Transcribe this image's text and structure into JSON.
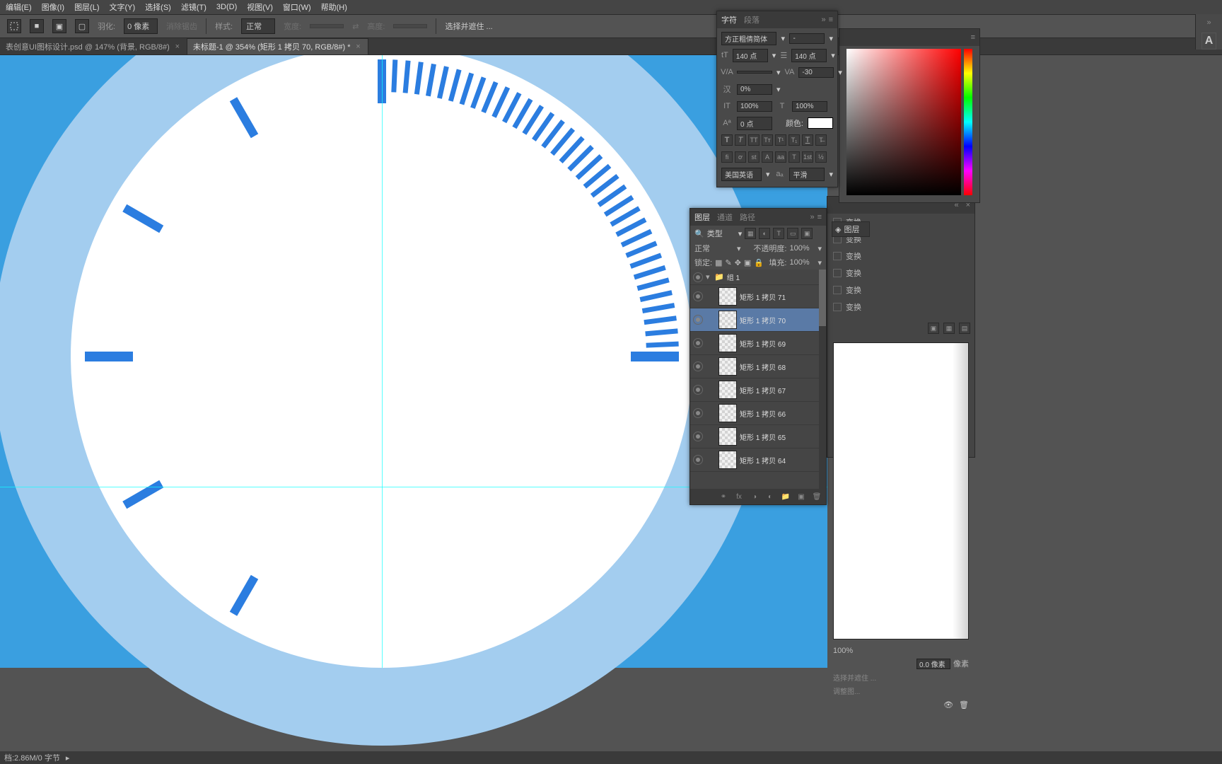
{
  "menu": [
    "编辑(E)",
    "图像(I)",
    "图层(L)",
    "文字(Y)",
    "选择(S)",
    "滤镜(T)",
    "3D(D)",
    "视图(V)",
    "窗口(W)",
    "帮助(H)"
  ],
  "options": {
    "feather_label": "羽化:",
    "feather_value": "0 像素",
    "anti_alias": "消除锯齿",
    "style_label": "样式:",
    "style_value": "正常",
    "width_label": "宽度:",
    "height_label": "高度:",
    "mask_btn": "选择并遮住 ..."
  },
  "tabs": [
    {
      "title": "表创意UI图标设计.psd @ 147% (背景, RGB/8#)",
      "active": false
    },
    {
      "title": "未标题-1 @ 354% (矩形 1 拷贝 70, RGB/8#) *",
      "active": true
    }
  ],
  "char": {
    "tab1": "字符",
    "tab2": "段落",
    "font": "方正粗倩简体",
    "style": "-",
    "size": "140 点",
    "leading": "140 点",
    "va": "",
    "tracking": "-30",
    "scale": "0%",
    "hscale": "100%",
    "vscale": "100%",
    "baseline": "0 点",
    "color_label": "颜色:",
    "lang": "美国英语",
    "aa": "平滑"
  },
  "layers": {
    "tab1": "图层",
    "tab2": "通道",
    "tab3": "路径",
    "kind_label": "类型",
    "blend": "正常",
    "opacity_label": "不透明度:",
    "opacity": "100%",
    "lock_label": "锁定:",
    "fill_label": "填充:",
    "fill": "100%",
    "group": "组 1",
    "items": [
      "矩形 1 拷贝 71",
      "矩形 1 拷贝 70",
      "矩形 1 拷贝 69",
      "矩形 1 拷贝 68",
      "矩形 1 拷贝 67",
      "矩形 1 拷贝 66",
      "矩形 1 拷贝 65",
      "矩形 1 拷贝 64"
    ]
  },
  "xform": {
    "items": [
      "变换",
      "变换",
      "变换",
      "变换",
      "变换",
      "变换"
    ],
    "percent": "100%",
    "px": "0.0 像素",
    "px_label": "像素",
    "row1": "选择并遮住 ...",
    "row2": "调整图..."
  },
  "dock_label": "图层",
  "status": {
    "left": "档:2.86M/0 字节",
    "arrow": "▸"
  }
}
